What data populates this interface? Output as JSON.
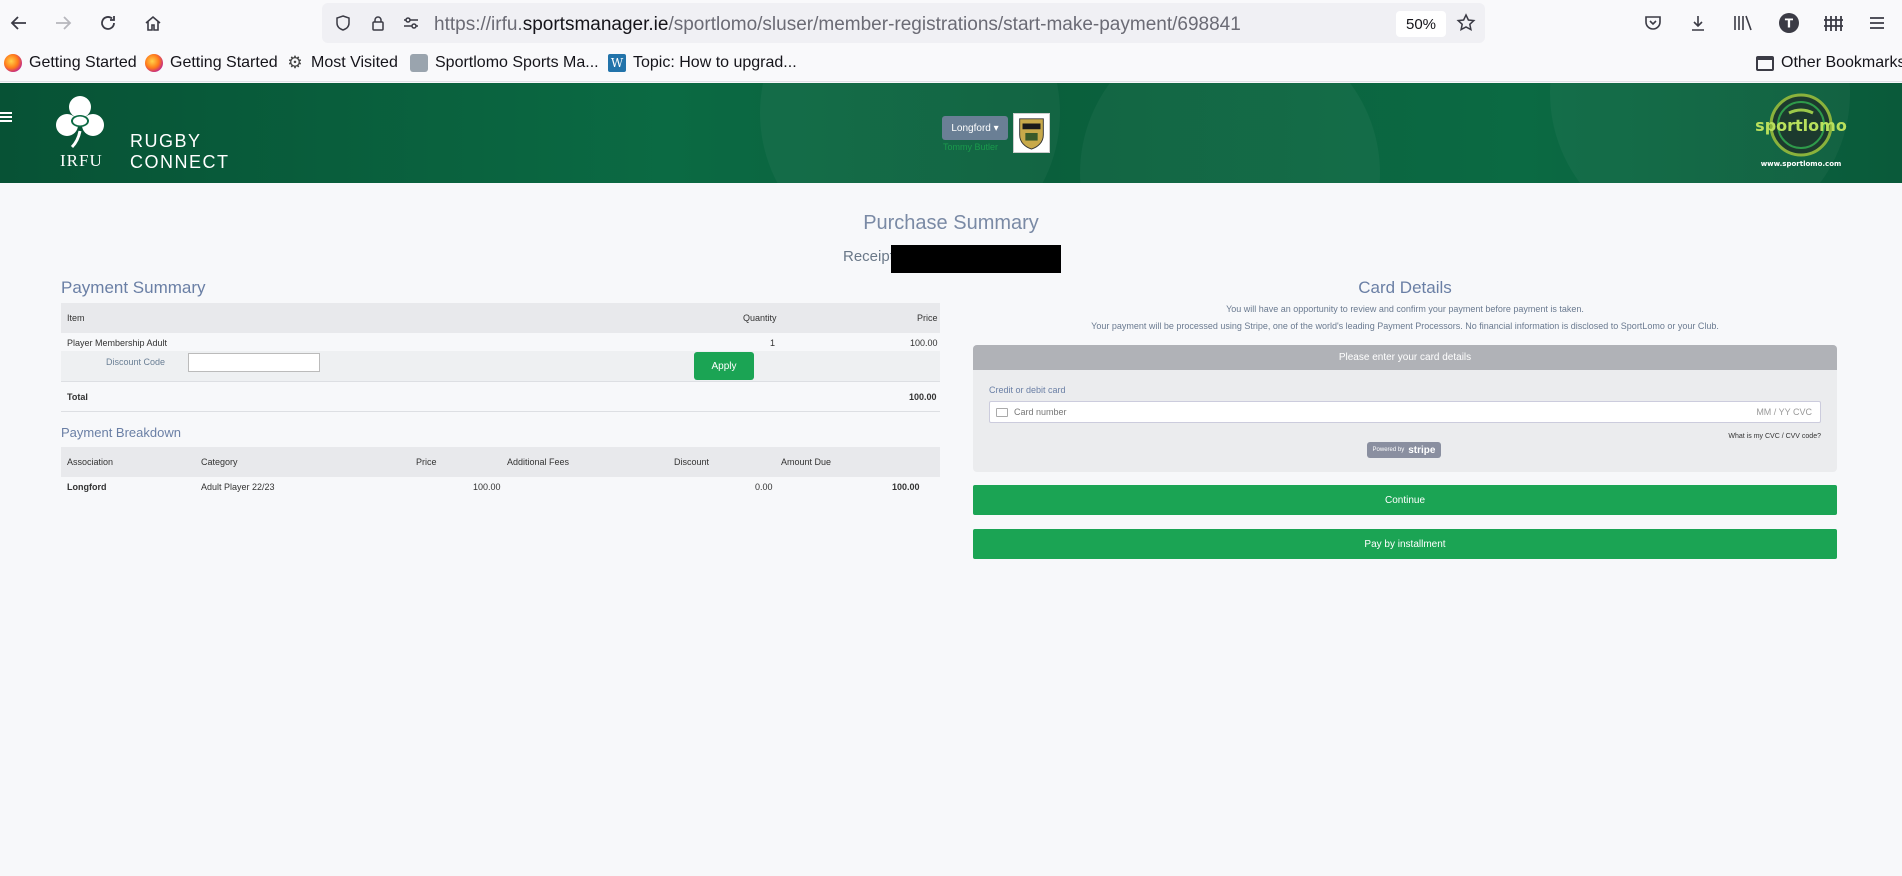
{
  "browser": {
    "url_prefix": "https://irfu.",
    "url_domain": "sportsmanager.ie",
    "url_path": "/sportlomo/sluser/member-registrations/start-make-payment/698841",
    "zoom": "50%"
  },
  "bookmarks": {
    "items": [
      {
        "label": "Getting Started",
        "icon": "firefox-icon"
      },
      {
        "label": "Getting Started",
        "icon": "firefox-icon"
      },
      {
        "label": "Most Visited",
        "icon": "gear-icon"
      },
      {
        "label": "Sportlomo Sports Ma...",
        "icon": "sportlomo-icon"
      },
      {
        "label": "Topic: How to upgrad...",
        "icon": "wordpress-icon"
      }
    ],
    "other": "Other Bookmarks"
  },
  "header": {
    "irfu": "IRFU",
    "brand_line1": "RUGBY",
    "brand_line2": "CONNECT",
    "club_select": "Longford ▾",
    "user_name": "Tommy Butler",
    "sportlomo_site": "www.sportlomo.com",
    "sportlomo_name": "sportlomo"
  },
  "page": {
    "title": "Purchase Summary",
    "receipt_label": "Receipt:"
  },
  "payment_summary": {
    "title": "Payment Summary",
    "headers": {
      "item": "Item",
      "quantity": "Quantity",
      "price": "Price"
    },
    "row": {
      "item": "Player Membership Adult",
      "quantity": "1",
      "price": "100.00"
    },
    "discount_label": "Discount Code",
    "discount_value": "",
    "apply_label": "Apply",
    "total_label": "Total",
    "total_value": "100.00"
  },
  "payment_breakdown": {
    "title": "Payment Breakdown",
    "headers": {
      "association": "Association",
      "category": "Category",
      "price": "Price",
      "additional_fees": "Additional Fees",
      "discount": "Discount",
      "amount_due": "Amount Due"
    },
    "row": {
      "association": "Longford",
      "category": "Adult Player 22/23",
      "price": "100.00",
      "additional_fees": "",
      "discount": "0.00",
      "amount_due": "100.00"
    }
  },
  "card_details": {
    "title": "Card Details",
    "note1": "You will have an opportunity to review and confirm your payment before payment is taken.",
    "note2": "Your payment will be processed using Stripe, one of the world's leading Payment Processors. No financial information is disclosed to SportLomo or your Club.",
    "panel_heading": "Please enter your card details",
    "cc_label": "Credit or debit card",
    "cc_placeholder": "Card number",
    "cc_exp_cvc": "MM / YY  CVC",
    "cvc_help": "What is my CVC / CVV code?",
    "stripe_small": "Powered by",
    "stripe_brand": "stripe",
    "continue_label": "Continue",
    "installment_label": "Pay by installment"
  }
}
